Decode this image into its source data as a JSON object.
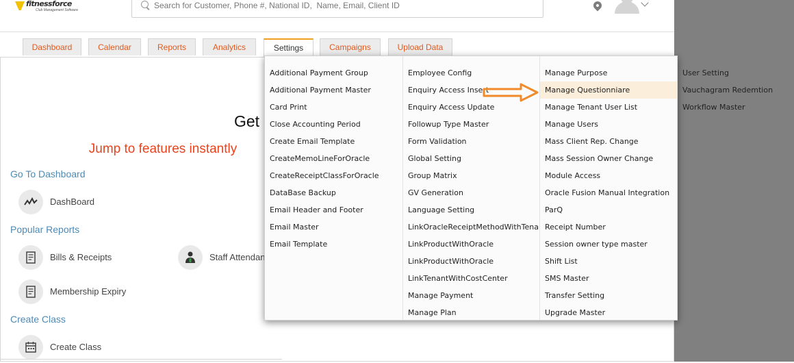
{
  "brand": {
    "name": "fitnessforce",
    "tagline": "Club Management Software"
  },
  "search": {
    "placeholder": "Search for Customer, Phone #, National ID,  Name, Email, Client ID"
  },
  "header_icons": [
    "location-pin-icon",
    "user-avatar-icon",
    "chevron-down-icon"
  ],
  "tabs": [
    {
      "label": "Dashboard"
    },
    {
      "label": "Calendar"
    },
    {
      "label": "Reports"
    },
    {
      "label": "Analytics"
    },
    {
      "label": "Settings",
      "active": true
    },
    {
      "label": "Campaigns"
    },
    {
      "label": "Upload Data"
    }
  ],
  "main": {
    "get_text": "Get",
    "jump_text": "Jump to features instantly",
    "sections": {
      "dashboard": "Go To Dashboard",
      "popular": "Popular Reports",
      "create_class": "Create Class"
    },
    "features": {
      "dashboard": {
        "label": "DashBoard",
        "icon": "trend-line-icon"
      },
      "bills": {
        "label": "Bills & Receipts",
        "icon": "receipt-icon"
      },
      "staff": {
        "label": "Staff Attendan",
        "icon": "staff-icon"
      },
      "membership": {
        "label": "Membership Expiry",
        "icon": "receipt-icon"
      },
      "create_class": {
        "label": "Create Class",
        "icon": "calendar-icon"
      }
    }
  },
  "settings_menu": {
    "highlighted": "Manage Questionniare",
    "highlight_color": "#fbeedb",
    "arrow_color": "#f08a2a",
    "columns": [
      [
        "Additional Payment Group",
        "Additional Payment Master",
        "Card Print",
        "Close Accounting Period",
        "Create Email Template",
        "CreateMemoLineForOracle",
        "CreateReceiptClassForOracle",
        "DataBase Backup",
        "Email Header and Footer",
        "Email Master",
        "Email Template"
      ],
      [
        "Employee Config",
        "Enquiry Access Insert",
        "Enquiry Access Update",
        "Followup Type Master",
        "Form Validation",
        "Global Setting",
        "Group Matrix",
        "GV Generation",
        "Language Setting",
        "LinkOracleReceiptMethodWithTenant",
        "LinkProductWithOracle",
        "LinkProductWithOracle",
        "LinkTenantWithCostCenter",
        "Manage Payment",
        "Manage Plan"
      ],
      [
        "Manage Purpose",
        "Manage Questionniare",
        "Manage Tenant User List",
        "Manage Users",
        "Mass Client Rep. Change",
        "Mass Session Owner Change",
        "Module Access",
        "Oracle Fusion Manual Integration",
        "ParQ",
        "Receipt Number",
        "Session owner type master",
        "Shift List",
        "SMS Master",
        "Transfer Setting",
        "Upgrade Master"
      ],
      [
        "User Setting",
        "Vauchagram Redemtion",
        "Workflow Master"
      ]
    ]
  },
  "colors": {
    "tab_text": "#e05a1e",
    "jump_text": "#e8431c",
    "section_text": "#4d8ab5",
    "active_tab_border": "#f0a020"
  }
}
